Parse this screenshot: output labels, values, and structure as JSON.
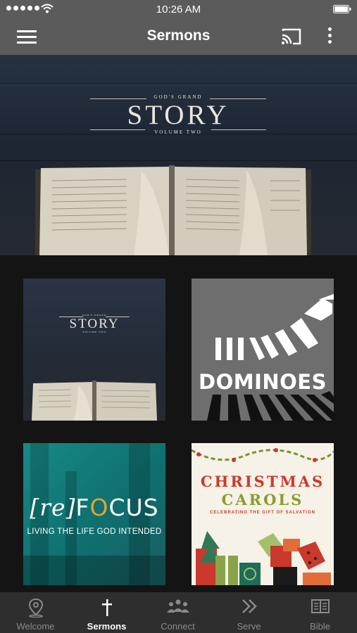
{
  "status_bar": {
    "time": "10:26 AM"
  },
  "app_bar": {
    "title": "Sermons"
  },
  "hero": {
    "series_top": "GOD'S GRAND",
    "series_main": "STORY",
    "series_bottom": "VOLUME TWO"
  },
  "grid": [
    {
      "top": "GOD'S GRAND",
      "main": "STORY",
      "bottom": "VOLUME TWO"
    },
    {
      "main": "DOMINOES"
    },
    {
      "main_prefix": "[re]",
      "main_rest": "F",
      "main_o": "O",
      "main_end": "CUS",
      "subtitle": "LIVING THE LIFE GOD INTENDED"
    },
    {
      "line1": "CHRISTMAS",
      "line2": "CAROLS",
      "subtitle": "CELEBRATING THE GIFT OF SALVATION"
    }
  ],
  "tabs": [
    {
      "label": "Welcome",
      "icon": "location-pin-icon"
    },
    {
      "label": "Sermons",
      "icon": "cross-icon",
      "active": true
    },
    {
      "label": "Connect",
      "icon": "people-icon"
    },
    {
      "label": "Serve",
      "icon": "double-chevron-icon"
    },
    {
      "label": "Bible",
      "icon": "book-icon"
    }
  ],
  "colors": {
    "app_bar": "#5b5b5b",
    "background": "#141414",
    "tab_bar": "#2e2e2e",
    "active_tab": "#ffffff",
    "inactive_tab": "#8a8a8a"
  }
}
